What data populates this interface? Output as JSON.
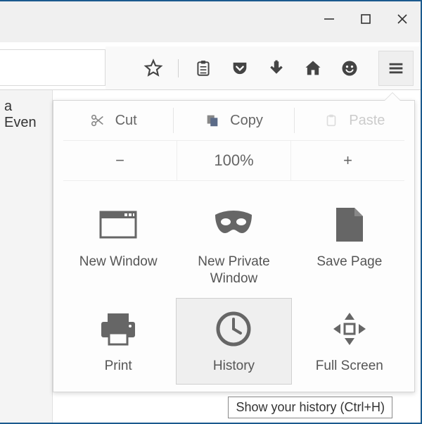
{
  "titlebar": {
    "minimize": "−",
    "maximize": "☐",
    "close": "✕"
  },
  "left_strip": {
    "visible_text": "a Even"
  },
  "edit": {
    "cut": {
      "label": "Cut"
    },
    "copy": {
      "label": "Copy"
    },
    "paste": {
      "label": "Paste"
    }
  },
  "zoom": {
    "minus": "−",
    "level": "100%",
    "plus": "+"
  },
  "grid": {
    "new_window": {
      "label": "New Window"
    },
    "private": {
      "label": "New Private Window"
    },
    "save_page": {
      "label": "Save Page"
    },
    "print": {
      "label": "Print"
    },
    "history": {
      "label": "History"
    },
    "full_screen": {
      "label": "Full Screen"
    }
  },
  "tooltip": {
    "text": "Show your history (Ctrl+H)"
  }
}
